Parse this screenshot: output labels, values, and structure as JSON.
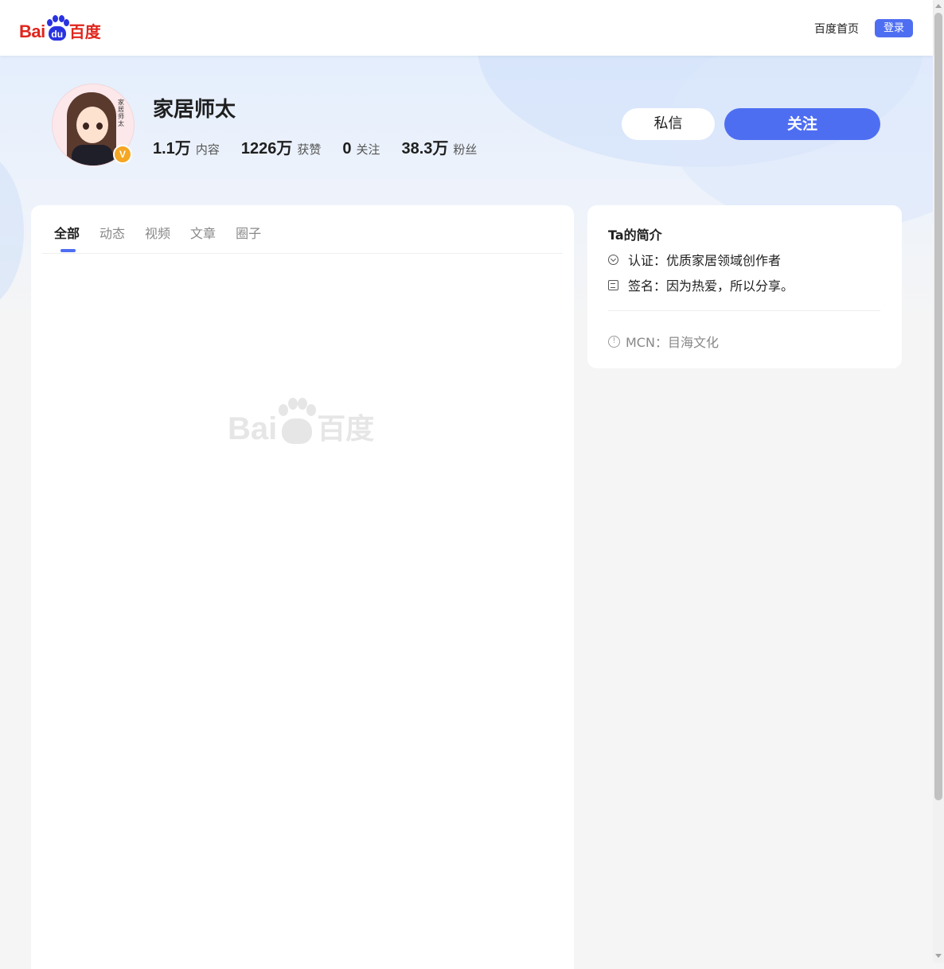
{
  "header": {
    "logo_latin": "Bai",
    "logo_paw_text": "du",
    "logo_cn": "百度",
    "home_link": "百度首页",
    "login_button": "登录"
  },
  "profile": {
    "name": "家居师太",
    "avatar_caption": "家居师太",
    "verified_badge": "V",
    "stats": [
      {
        "value": "1.1万",
        "label": "内容"
      },
      {
        "value": "1226万",
        "label": "获赞"
      },
      {
        "value": "0",
        "label": "关注"
      },
      {
        "value": "38.3万",
        "label": "粉丝"
      }
    ],
    "message_button": "私信",
    "follow_button": "关注"
  },
  "tabs": [
    "全部",
    "动态",
    "视频",
    "文章",
    "圈子"
  ],
  "active_tab": "全部",
  "placeholder_logo": {
    "latin": "Bai",
    "cn": "百度"
  },
  "intro": {
    "title": "Ta的简介",
    "certification": "认证：优质家居领域创作者",
    "signature": "签名：因为热爱，所以分享。",
    "mcn": "MCN：目海文化"
  },
  "colors": {
    "accent": "#4e6ef2",
    "brand_red": "#e0251c",
    "brand_blue": "#2932e1",
    "badge_gold": "#f5a623"
  },
  "icons": {
    "certification": "check-circle-icon",
    "signature": "document-icon",
    "mcn": "info-circle-icon"
  }
}
